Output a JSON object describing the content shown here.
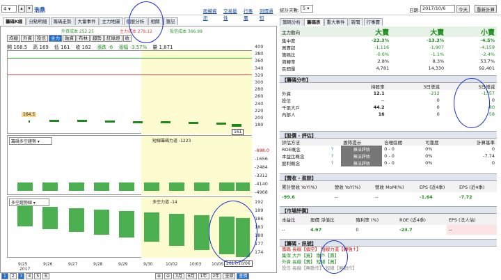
{
  "top": {
    "select_value": "4",
    "stock_name": "浩鼎",
    "links": [
      "股權資訊",
      "交易量性",
      "行事曆",
      "到價通知"
    ]
  },
  "tabs1": [
    "籌碼K線",
    "分點明細",
    "籌碼走勢",
    "大量事件",
    "主力地圖",
    "個股分析",
    "相關",
    "筆記"
  ],
  "legend_top": {
    "a": "外資成本 252.25",
    "b": "主力成本 278.12",
    "c": "投信成本 366.99"
  },
  "tabs2": [
    "均線",
    "外資",
    "投信",
    "主力",
    "融資",
    "布林",
    "趨勢",
    "紅綠燈",
    "收"
  ],
  "ohlc": {
    "open": "開 168.5",
    "high": "高 169",
    "low": "低 161",
    "close": "收 162",
    "change": "漲跌 -6",
    "pct": "漲幅 -3.57%",
    "vol": "量 1,871"
  },
  "y_main": [
    "400",
    "380",
    "360",
    "340",
    "320",
    "300",
    "280",
    "260",
    "240",
    "220",
    "200",
    "180"
  ],
  "price_marks": [
    "164.5",
    "161"
  ],
  "panel2": {
    "select": "籌碼多空趨勢",
    "legend": "短線籌碼力道 -1223",
    "y": [
      "-698.0",
      "-1656",
      "-2484",
      "-3312",
      "-4140",
      "-4968"
    ]
  },
  "panel3": {
    "select": "多空趨勢線",
    "legend": "多空力道 -14",
    "y": [
      "192",
      "189",
      "186",
      "183",
      "180",
      "177",
      "174"
    ]
  },
  "x_labels": [
    "9/25",
    "9/26",
    "9/27",
    "9/28",
    "9/29",
    "9/30",
    "10/02",
    "10/03",
    "10/05"
  ],
  "x_year": "2017",
  "cursor_date": "2017/10/06",
  "bottom": {
    "pages": [
      "1",
      "2",
      "3",
      "4",
      "5",
      "6"
    ],
    "ranges": [
      "3月",
      "6月",
      "1年",
      "2年",
      "全部",
      "查價"
    ]
  },
  "right": {
    "top_label": "統計天數:",
    "days": "5",
    "date_label": "日期:",
    "date": "2017/10/6",
    "today": "今天",
    "btn2": "重新計算",
    "tabs": [
      "籌碼分析",
      "籌碼表",
      "重大事件",
      "新聞",
      "行事曆"
    ],
    "summary": {
      "head": [
        "主力動向",
        "大賣",
        "大賣",
        "小賣"
      ],
      "rows": [
        [
          "集中度",
          "-23.3%",
          "-13.3%",
          "-4.5%"
        ],
        [
          "買賣超",
          "-1,116",
          "-1,907",
          "-4,159"
        ],
        [
          "籌碼比",
          "-0.6%",
          "-1.1%",
          "-2.4%"
        ],
        [
          "周轉率",
          "2.8%",
          "8.3%",
          "53.7%"
        ],
        [
          "區間量",
          "4,781",
          "14,330",
          "92,401"
        ]
      ]
    },
    "dist": {
      "title": "【籌碼分布】",
      "head": [
        "",
        "持股率",
        "3日增減",
        "5日增減"
      ],
      "rows": [
        [
          "外資",
          "12.1",
          "-212",
          "-1357"
        ],
        [
          "投信",
          "--",
          "0",
          "0"
        ],
        [
          "千張大戶",
          "44.2",
          "0",
          "-80"
        ],
        [
          "內部人",
          "16",
          "0",
          "-58"
        ]
      ]
    },
    "eval": {
      "title": "【股價 - 評估】",
      "head": [
        "評估方法",
        "",
        "團隊提示",
        "合理區間",
        "可靠度",
        "計算基準"
      ],
      "rows": [
        [
          "ROE概念",
          "?",
          "無法評估",
          "0 - 0",
          "0%",
          "0"
        ],
        [
          "本益比概念",
          "?",
          "無法評估",
          "0 - 0",
          "0%",
          "-7.74"
        ],
        [
          "股利概念",
          "?",
          "無法評估",
          "0 - 0",
          "0%",
          "0"
        ]
      ]
    },
    "rev": {
      "title": "【營收 - 盈餘】",
      "head": [
        "累計營收 YoY(%)",
        "營收 YoY(%)",
        "營收 MoM(%)",
        "EPS (近4季)",
        "EPS (近4季)"
      ],
      "row": [
        "-99.6",
        "--",
        "--",
        "-1.64",
        "-7.72"
      ]
    },
    "market": {
      "title": "【市場評價】",
      "head": [
        "本益比",
        "股價 淨值比",
        "殖利率 (%)",
        "ROE (近4季)",
        "EPS (法人估)"
      ],
      "row": [
        "--",
        "4.97",
        "0",
        "-23.7",
        "--"
      ]
    },
    "signal": {
      "title": "【籌碼 - 訊號】",
      "lines": [
        "籌碼 長線【偏空】 短線力道【轉強↑】",
        "集保 大戶【買】 散戶【賣】",
        "外資 長線【賣】 短線【買】",
        "投信 長線【無動作】 短線【無動作】"
      ]
    }
  }
}
